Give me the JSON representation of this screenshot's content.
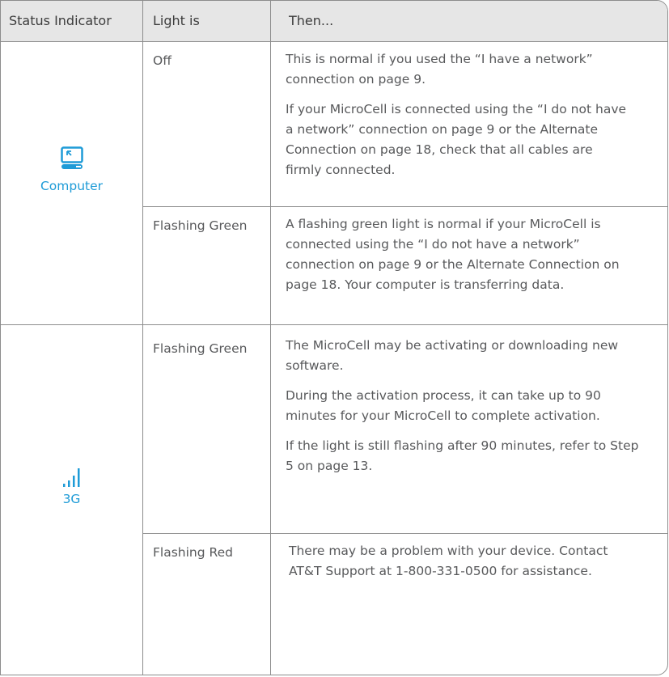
{
  "table": {
    "headers": [
      "Status Indicator",
      "Light is",
      "Then..."
    ],
    "groups": [
      {
        "indicator": {
          "label": "Computer",
          "icon": "computer-icon"
        },
        "rows": [
          {
            "light": "Off",
            "then": [
              "This is normal if you used the “I have a network” connection on page 9.",
              "If your MicroCell is connected using the “I do not have a network” connection on page 9 or the Alternate Connection on page 18, check that all cables are firmly connected."
            ]
          },
          {
            "light": "Flashing Green",
            "then": [
              "A flashing green light is normal if your MicroCell is connected using the “I do not have a network” connection on page 9 or the Alternate Connection on page 18. Your computer is transferring data."
            ]
          }
        ]
      },
      {
        "indicator": {
          "label": "3G",
          "icon": "signal-bars-icon"
        },
        "rows": [
          {
            "light": "Flashing Green",
            "then": [
              "The MicroCell may be activating or downloading new software.",
              "During the activation process, it can take up to 90 minutes for your MicroCell to complete activation.",
              "If the light is still flashing after 90 minutes, refer to Step 5 on page 13."
            ]
          },
          {
            "light": "Flashing Red",
            "then": [
              "There may be a problem with your device. Contact AT&T Support at 1-800-331-0500 for assistance."
            ]
          }
        ]
      }
    ]
  },
  "colors": {
    "accent": "#1e9bd7",
    "header_bg": "#e6e6e6",
    "border": "#8c8c8c",
    "text": "#58595b"
  }
}
